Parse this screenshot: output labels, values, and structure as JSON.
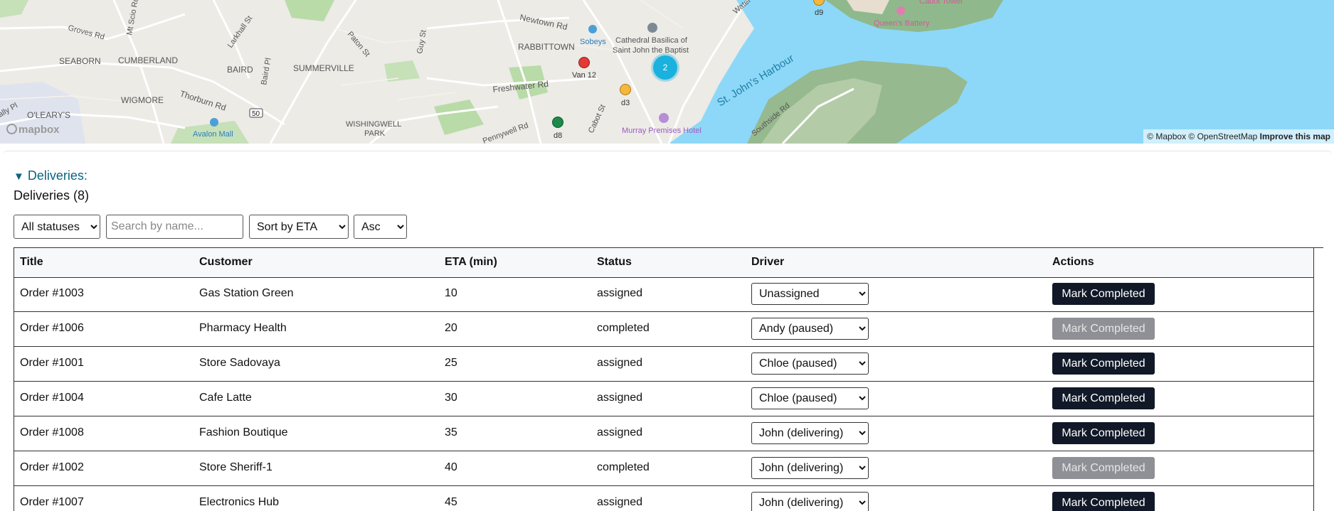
{
  "map": {
    "labels": {
      "groves_rd": "Groves Rd",
      "mt_scio_rd": "Mt Scio Rd",
      "larkhall_st": "Larkhall St",
      "paton_st": "Paton St",
      "guy_st": "Guy St",
      "newtown_rd": "Newtown Rd",
      "rabbittown": "RABBITTOWN",
      "sobeys": "Sobeys",
      "cathedral_1": "Cathedral Basilica of",
      "cathedral_2": "Saint John the Baptist",
      "seaborn": "SEABORN",
      "cumberland": "CUMBERLAND",
      "baird": "BAIRD",
      "baird_pl": "Baird Pl",
      "summerville": "SUMMERVILLE",
      "wigmore": "WIGMORE",
      "thorburn_rd": "Thorburn Rd",
      "route_50": "50",
      "olearys": "O'LEARY'S",
      "ally_pl": "ally Pl",
      "avalon_mall": "Avalon Mall",
      "wishingwell_1": "WISHINGWELL",
      "wishingwell_2": "PARK",
      "freshwater_rd": "Freshwater Rd",
      "pennywell_rd": "Pennywell Rd",
      "cabot_st": "Cabot St",
      "murray": "Murray Premises Hotel",
      "harbour": "St. John's Harbour",
      "southside_rd": "Southside Rd",
      "queens_battery": "Queen's Battery",
      "cabot_tower": "Cabot Tower",
      "water": "Water"
    },
    "markers": [
      {
        "label": "Van 12",
        "color": "#e53935"
      },
      {
        "label": "d3",
        "color": "#f5b73c"
      },
      {
        "label": "d8",
        "color": "#1b8a4a"
      },
      {
        "label": "d9",
        "color": "#f5b73c"
      }
    ],
    "cluster_count": "2",
    "logo": "mapbox",
    "attribution": "© Mapbox © OpenStreetMap",
    "improve_link": "Improve this map"
  },
  "section": {
    "summary": "Deliveries:",
    "heading": "Deliveries (8)"
  },
  "controls": {
    "status_filter": "All statuses",
    "search_placeholder": "Search by name...",
    "sort_by": "Sort by ETA",
    "order": "Asc"
  },
  "table": {
    "headers": {
      "title": "Title",
      "customer": "Customer",
      "eta": "ETA (min)",
      "status": "Status",
      "driver": "Driver",
      "actions": "Actions"
    },
    "rows": [
      {
        "title": "Order #1003",
        "customer": "Gas Station Green",
        "eta": "10",
        "status": "assigned",
        "driver": "Unassigned",
        "action": "Mark Completed",
        "enabled": true
      },
      {
        "title": "Order #1006",
        "customer": "Pharmacy Health",
        "eta": "20",
        "status": "completed",
        "driver": "Andy (paused)",
        "action": "Mark Completed",
        "enabled": false
      },
      {
        "title": "Order #1001",
        "customer": "Store Sadovaya",
        "eta": "25",
        "status": "assigned",
        "driver": "Chloe (paused)",
        "action": "Mark Completed",
        "enabled": true
      },
      {
        "title": "Order #1004",
        "customer": "Cafe Latte",
        "eta": "30",
        "status": "assigned",
        "driver": "Chloe (paused)",
        "action": "Mark Completed",
        "enabled": true
      },
      {
        "title": "Order #1008",
        "customer": "Fashion Boutique",
        "eta": "35",
        "status": "assigned",
        "driver": "John (delivering)",
        "action": "Mark Completed",
        "enabled": true
      },
      {
        "title": "Order #1002",
        "customer": "Store Sheriff-1",
        "eta": "40",
        "status": "completed",
        "driver": "John (delivering)",
        "action": "Mark Completed",
        "enabled": false
      },
      {
        "title": "Order #1007",
        "customer": "Electronics Hub",
        "eta": "45",
        "status": "assigned",
        "driver": "John (delivering)",
        "action": "Mark Completed",
        "enabled": true
      }
    ]
  },
  "colors": {
    "water": "#8dd8f8",
    "land": "#ecebe6",
    "park": "#b9dba8",
    "button": "#111827",
    "button_disabled": "#8e9096",
    "summary_text": "#0b6480",
    "cluster": "#1ab1de"
  }
}
